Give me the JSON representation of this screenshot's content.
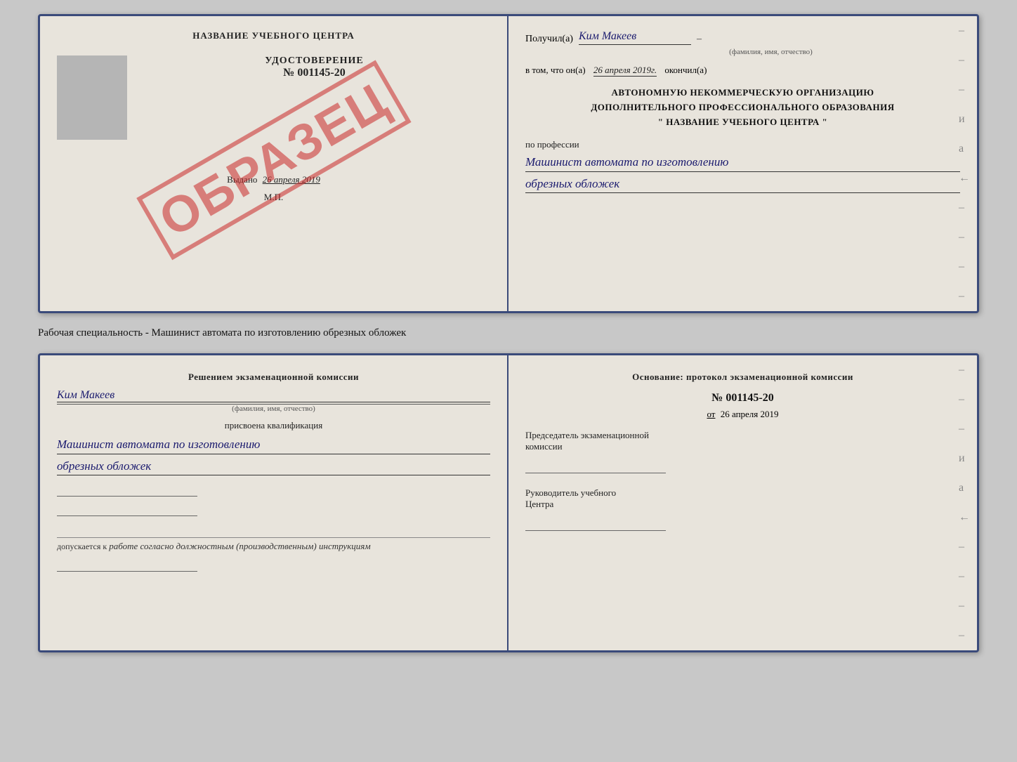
{
  "top_doc": {
    "left": {
      "training_center": "НАЗВАНИЕ УЧЕБНОГО ЦЕНТРА",
      "udostoverenie_label": "УДОСТОВЕРЕНИЕ",
      "nomer": "№ 001145-20",
      "vydano": "Выдано",
      "vydano_date": "26 апреля 2019",
      "mp": "М.П.",
      "watermark": "ОБРАЗЕЦ"
    },
    "right": {
      "poluchil": "Получил(а)",
      "receiver_name": "Ким Макеев",
      "fio_label": "(фамилия, имя, отчество)",
      "vtom": "в том, что он(а)",
      "date": "26 апреля 2019г.",
      "okonchill": "окончил(а)",
      "org_line1": "АВТОНОМНУЮ НЕКОММЕРЧЕСКУЮ ОРГАНИЗАЦИЮ",
      "org_line2": "ДОПОЛНИТЕЛЬНОГО ПРОФЕССИОНАЛЬНОГО ОБРАЗОВАНИЯ",
      "org_name": "\"   НАЗВАНИЕ УЧЕБНОГО ЦЕНТРА   \"",
      "po_professii": "по профессии",
      "profession1": "Машинист автомата по изготовлению",
      "profession2": "обрезных обложек"
    }
  },
  "caption": "Рабочая специальность - Машинист автомата по изготовлению обрезных обложек",
  "bottom_doc": {
    "left": {
      "resheniem": "Решением экзаменационной комиссии",
      "name": "Ким Макеев",
      "fio_label": "(фамилия, имя, отчество)",
      "prisvoena": "присвоена квалификация",
      "kvalif1": "Машинист автомата по изготовлению",
      "kvalif2": "обрезных обложек",
      "dopuskaetsya": "допускается к",
      "dopusk_text": "работе согласно должностным (производственным) инструкциям"
    },
    "right": {
      "osnovanie": "Основание: протокол экзаменационной комиссии",
      "nomer": "№  001145-20",
      "ot": "от",
      "date": "26 апреля 2019",
      "predsedatel_line1": "Председатель экзаменационной",
      "predsedatel_line2": "комиссии",
      "rukov_line1": "Руководитель учебного",
      "rukov_line2": "Центра"
    }
  },
  "dashes": [
    "–",
    "–",
    "–",
    "и",
    "а",
    "←",
    "–",
    "–",
    "–",
    "–"
  ]
}
